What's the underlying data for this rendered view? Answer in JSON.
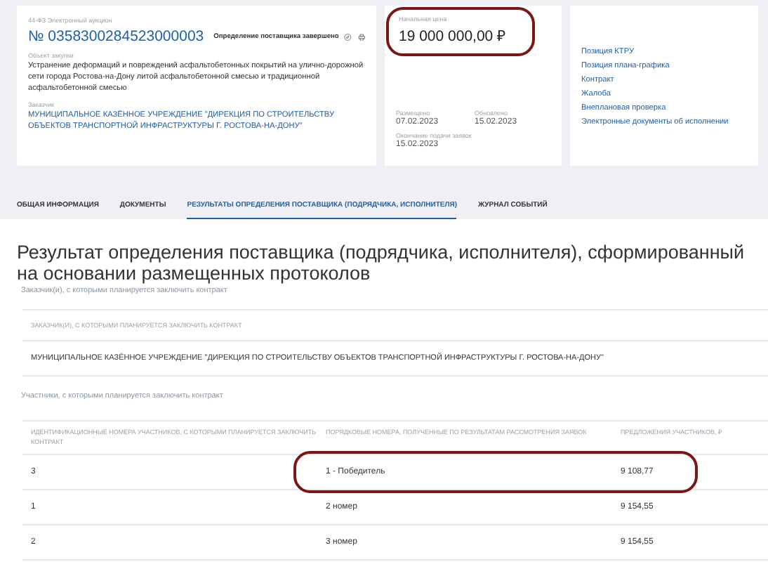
{
  "header": {
    "law": "44-ФЗ Электронный аукцион",
    "number": "№ 0358300284523000003",
    "status": "Определение поставщика завершено",
    "object_label": "Объект закупки",
    "object": "Устранение деформаций и повреждений асфальтобетонных покрытий на улично-дорожной сети города Ростова-на-Дону литой асфальтобетонной смесью и традиционной асфальтобетонной смесью",
    "customer_label": "Заказчик",
    "customer": "МУНИЦИПАЛЬНОЕ КАЗЁННОЕ УЧРЕЖДЕНИЕ \"ДИРЕКЦИЯ ПО СТРОИТЕЛЬСТВУ ОБЪЕКТОВ ТРАНСПОРТНОЙ ИНФРАСТРУКТУРЫ Г. РОСТОВА-НА-ДОНУ\""
  },
  "price": {
    "label": "Начальная цена",
    "value": "19 000 000,00 ₽"
  },
  "dates": [
    {
      "label": "Размещено",
      "value": "07.02.2023"
    },
    {
      "label": "Обновлено",
      "value": "15.02.2023"
    },
    {
      "label": "Окончание подачи заявок",
      "value": "15.02.2023"
    }
  ],
  "links": [
    "Позиция КТРУ",
    "Позиция плана-графика",
    "Контракт",
    "Жалоба",
    "Внеплановая проверка",
    "Электронные документы об исполнении"
  ],
  "tabs": [
    {
      "label": "ОБЩАЯ ИНФОРМАЦИЯ",
      "selected": false
    },
    {
      "label": "ДОКУМЕНТЫ",
      "selected": false
    },
    {
      "label": "РЕЗУЛЬТАТЫ ОПРЕДЕЛЕНИЯ ПОСТАВЩИКА (ПОДРЯДЧИКА, ИСПОЛНИТЕЛЯ)",
      "selected": true
    },
    {
      "label": "ЖУРНАЛ СОБЫТИЙ",
      "selected": false
    }
  ],
  "title": "Результат определения поставщика (подрядчика, исполнителя), сформированный на основании размещенных протоколов",
  "customers_caption": "Заказчик(и), с которыми планируется заключить контракт",
  "customers_table": {
    "header": "ЗАКАЗЧИК(И), С КОТОРЫМИ ПЛАНИРУЕТСЯ ЗАКЛЮЧИТЬ КОНТРАКТ",
    "rows": [
      "МУНИЦИПАЛЬНОЕ КАЗЁННОЕ УЧРЕЖДЕНИЕ \"ДИРЕКЦИЯ ПО СТРОИТЕЛЬСТВУ ОБЪЕКТОВ ТРАНСПОРТНОЙ ИНФРАСТРУКТУРЫ Г. РОСТОВА-НА-ДОНУ\""
    ]
  },
  "participants_caption": "Участники, с которыми планируется заключить контракт",
  "participants_table": {
    "columns": [
      "ИДЕНТИФИКАЦИОННЫЕ НОМЕРА УЧАСТНИКОВ, С КОТОРЫМИ ПЛАНИРУЕТСЯ ЗАКЛЮЧИТЬ КОНТРАКТ",
      "ПОРЯДКОВЫЕ НОМЕРА, ПОЛУЧЕННЫЕ ПО РЕЗУЛЬТАТАМ РАССМОТРЕНИЯ ЗАЯВОК",
      "ПРЕДЛОЖЕНИЯ УЧАСТНИКОВ, ₽"
    ],
    "rows": [
      {
        "cells": [
          "3",
          "1 - Победитель",
          "9 108,77"
        ],
        "circled": true
      },
      {
        "cells": [
          "1",
          "2 номер",
          "9 154,55"
        ],
        "circled": false
      },
      {
        "cells": [
          "2",
          "3 номер",
          "9 154,55"
        ],
        "circled": false
      }
    ]
  }
}
